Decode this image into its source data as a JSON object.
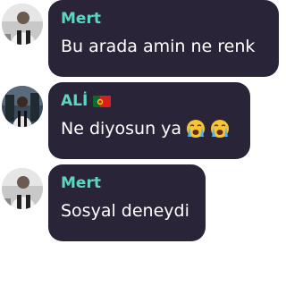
{
  "messages": [
    {
      "sender": "Mert",
      "text": "Bu arada amin ne renk",
      "avatar_icon": "profile-photo-mert",
      "flag_icon": null,
      "emojis": []
    },
    {
      "sender": "ALİ",
      "text": "Ne diyosun ya",
      "avatar_icon": "profile-photo-ali",
      "flag_icon": "portugal-flag-icon",
      "emojis": [
        "loudly-crying-face-icon",
        "loudly-crying-face-icon"
      ]
    },
    {
      "sender": "Mert",
      "text": "Sosyal deneydi",
      "avatar_icon": "profile-photo-mert",
      "flag_icon": null,
      "emojis": []
    }
  ],
  "colors": {
    "bubble_bg": "#2a2438",
    "sender_name": "#5cd6c2",
    "message_text": "#ffffff",
    "page_bg": "#ffffff"
  }
}
